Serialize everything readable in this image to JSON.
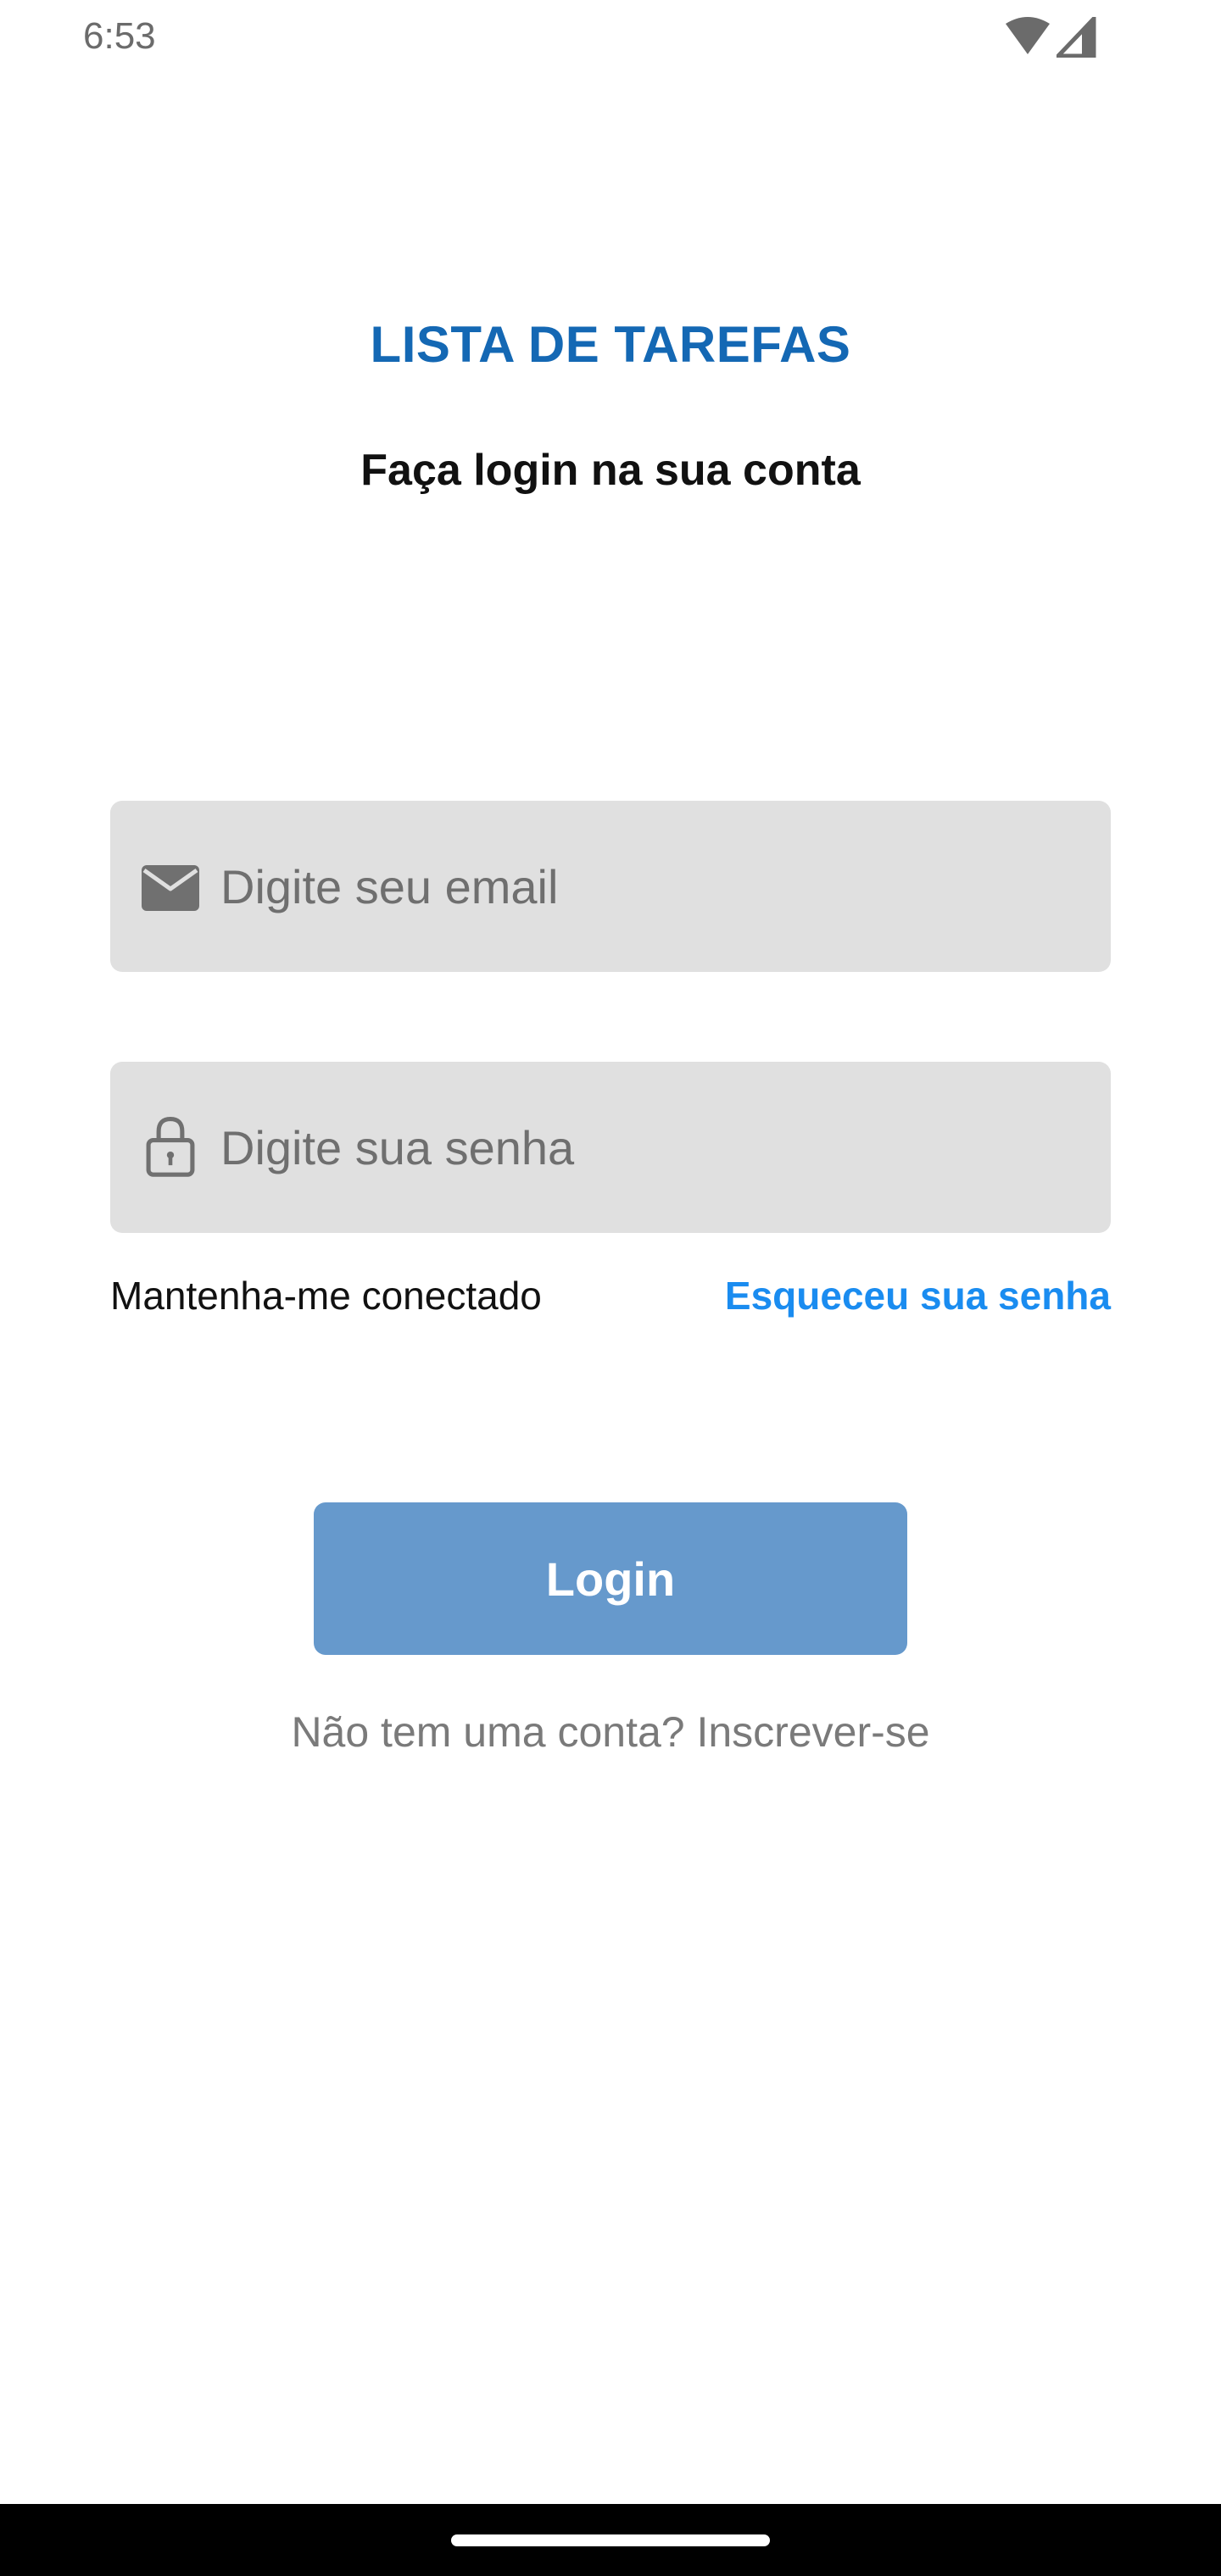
{
  "status_bar": {
    "time": "6:53",
    "icons": [
      "wifi-icon",
      "cellular-signal-icon"
    ]
  },
  "header": {
    "app_title": "LISTA DE TAREFAS",
    "subtitle": "Faça login na sua conta"
  },
  "form": {
    "email": {
      "icon": "mail-icon",
      "placeholder": "Digite seu email",
      "value": ""
    },
    "password": {
      "icon": "lock-icon",
      "placeholder": "Digite sua senha",
      "value": ""
    },
    "remember_label": "Mantenha-me conectado",
    "forgot_label": "Esqueceu sua senha",
    "login_label": "Login"
  },
  "footer": {
    "no_account": "Não tem uma conta?",
    "signup": "Inscrever-se"
  },
  "colors": {
    "title": "#1468b4",
    "link": "#1a8cf0",
    "button": "#6699cc",
    "field_bg": "#e0e0e0"
  }
}
